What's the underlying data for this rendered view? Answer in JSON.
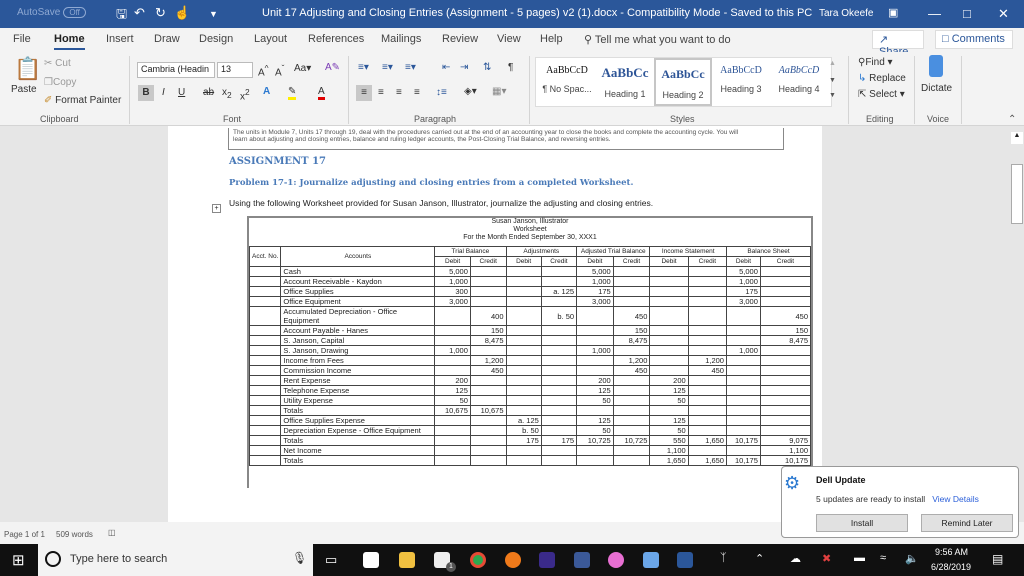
{
  "titlebar": {
    "autosave_label": "AutoSave",
    "autosave_state": "Off",
    "doc_title": "Unit 17 Adjusting and Closing Entries (Assignment - 5 pages) v2 (1).docx  -  Compatibility Mode  -  Saved to this PC",
    "user": "Tara Okeefe"
  },
  "tabs": [
    "File",
    "Home",
    "Insert",
    "Draw",
    "Design",
    "Layout",
    "References",
    "Mailings",
    "Review",
    "View",
    "Help"
  ],
  "active_tab": "Home",
  "tell_me": "Tell me what you want to do",
  "share_label": "Share",
  "comments_label": "Comments",
  "ribbon": {
    "clipboard": {
      "paste": "Paste",
      "cut": "Cut",
      "copy": "Copy",
      "format_painter": "Format Painter",
      "label": "Clipboard"
    },
    "font": {
      "name": "Cambria (Headin",
      "size": "13",
      "label": "Font"
    },
    "paragraph": {
      "label": "Paragraph"
    },
    "styles": {
      "label": "Styles",
      "items": [
        {
          "preview": "AaBbCcD",
          "name": "¶ No Spac..."
        },
        {
          "preview": "AaBbCc",
          "name": "Heading 1"
        },
        {
          "preview": "AaBbCc",
          "name": "Heading 2"
        },
        {
          "preview": "AaBbCcD",
          "name": "Heading 3"
        },
        {
          "preview": "AaBbCcD",
          "name": "Heading 4"
        }
      ],
      "selected": "Heading 2"
    },
    "editing": {
      "find": "Find",
      "replace": "Replace",
      "select": "Select",
      "label": "Editing"
    },
    "voice": {
      "dictate": "Dictate",
      "label": "Voice"
    }
  },
  "document": {
    "intro_line1": "The units in Module 7, Units 17 through 19, deal with the procedures carried out at the end of an accounting year to close the books and complete the accounting cycle.  You will",
    "intro_line2": "learn about adjusting and closing entries, balance and ruling ledger accounts, the Post-Closing Trial Balance, and reversing entries.",
    "assignment": "ASSIGNMENT 17",
    "problem": "Problem 17-1:  Journalize adjusting and closing entries from a completed Worksheet.",
    "instruction": "Using the following Worksheet provided for Susan Janson, Illustrator, journalize the adjusting and closing entries.",
    "worksheet": {
      "company": "Susan Janson, Illustrator",
      "title": "Worksheet",
      "period": "For the Month Ended September 30, XXX1",
      "col_groups": [
        "Trial Balance",
        "Adjustments",
        "Adjusted Trial Balance",
        "Income Statement",
        "Balance Sheet"
      ],
      "acct_no": "Acct. No.",
      "accounts_header": "Accounts",
      "debit": "Debit",
      "credit": "Credit",
      "rows": [
        {
          "acct": "Cash",
          "tb_dr": "5,000",
          "tb_cr": "",
          "adj_dr": "",
          "adj_cr": "",
          "atb_dr": "5,000",
          "atb_cr": "",
          "is_dr": "",
          "is_cr": "",
          "bs_dr": "5,000",
          "bs_cr": ""
        },
        {
          "acct": "Account Receivable - Kaydon",
          "tb_dr": "1,000",
          "tb_cr": "",
          "adj_dr": "",
          "adj_cr": "",
          "atb_dr": "1,000",
          "atb_cr": "",
          "is_dr": "",
          "is_cr": "",
          "bs_dr": "1,000",
          "bs_cr": ""
        },
        {
          "acct": "Office Supplies",
          "tb_dr": "300",
          "tb_cr": "",
          "adj_dr": "",
          "adj_cr": "a.  125",
          "atb_dr": "175",
          "atb_cr": "",
          "is_dr": "",
          "is_cr": "",
          "bs_dr": "175",
          "bs_cr": ""
        },
        {
          "acct": "Office Equipment",
          "tb_dr": "3,000",
          "tb_cr": "",
          "adj_dr": "",
          "adj_cr": "",
          "atb_dr": "3,000",
          "atb_cr": "",
          "is_dr": "",
          "is_cr": "",
          "bs_dr": "3,000",
          "bs_cr": ""
        },
        {
          "acct": "Accumulated Depreciation - Office Equipment",
          "tb_dr": "",
          "tb_cr": "400",
          "adj_dr": "",
          "adj_cr": "b.   50",
          "atb_dr": "",
          "atb_cr": "450",
          "is_dr": "",
          "is_cr": "",
          "bs_dr": "",
          "bs_cr": "450"
        },
        {
          "acct": "Account Payable - Hanes",
          "tb_dr": "",
          "tb_cr": "150",
          "adj_dr": "",
          "adj_cr": "",
          "atb_dr": "",
          "atb_cr": "150",
          "is_dr": "",
          "is_cr": "",
          "bs_dr": "",
          "bs_cr": "150"
        },
        {
          "acct": "S. Janson, Capital",
          "tb_dr": "",
          "tb_cr": "8,475",
          "adj_dr": "",
          "adj_cr": "",
          "atb_dr": "",
          "atb_cr": "8,475",
          "is_dr": "",
          "is_cr": "",
          "bs_dr": "",
          "bs_cr": "8,475"
        },
        {
          "acct": "S. Janson, Drawing",
          "tb_dr": "1,000",
          "tb_cr": "",
          "adj_dr": "",
          "adj_cr": "",
          "atb_dr": "1,000",
          "atb_cr": "",
          "is_dr": "",
          "is_cr": "",
          "bs_dr": "1,000",
          "bs_cr": ""
        },
        {
          "acct": "Income from Fees",
          "tb_dr": "",
          "tb_cr": "1,200",
          "adj_dr": "",
          "adj_cr": "",
          "atb_dr": "",
          "atb_cr": "1,200",
          "is_dr": "",
          "is_cr": "1,200",
          "bs_dr": "",
          "bs_cr": ""
        },
        {
          "acct": "Commission Income",
          "tb_dr": "",
          "tb_cr": "450",
          "adj_dr": "",
          "adj_cr": "",
          "atb_dr": "",
          "atb_cr": "450",
          "is_dr": "",
          "is_cr": "450",
          "bs_dr": "",
          "bs_cr": ""
        },
        {
          "acct": "Rent Expense",
          "tb_dr": "200",
          "tb_cr": "",
          "adj_dr": "",
          "adj_cr": "",
          "atb_dr": "200",
          "atb_cr": "",
          "is_dr": "200",
          "is_cr": "",
          "bs_dr": "",
          "bs_cr": ""
        },
        {
          "acct": "Telephone Expense",
          "tb_dr": "125",
          "tb_cr": "",
          "adj_dr": "",
          "adj_cr": "",
          "atb_dr": "125",
          "atb_cr": "",
          "is_dr": "125",
          "is_cr": "",
          "bs_dr": "",
          "bs_cr": ""
        },
        {
          "acct": "Utility Expense",
          "tb_dr": "50",
          "tb_cr": "",
          "adj_dr": "",
          "adj_cr": "",
          "atb_dr": "50",
          "atb_cr": "",
          "is_dr": "50",
          "is_cr": "",
          "bs_dr": "",
          "bs_cr": ""
        },
        {
          "acct": "   Totals",
          "tb_dr": "10,675",
          "tb_cr": "10,675",
          "adj_dr": "",
          "adj_cr": "",
          "atb_dr": "",
          "atb_cr": "",
          "is_dr": "",
          "is_cr": "",
          "bs_dr": "",
          "bs_cr": ""
        },
        {
          "acct": "Office Supplies Expense",
          "tb_dr": "",
          "tb_cr": "",
          "adj_dr": "a.    125",
          "adj_cr": "",
          "atb_dr": "125",
          "atb_cr": "",
          "is_dr": "125",
          "is_cr": "",
          "bs_dr": "",
          "bs_cr": ""
        },
        {
          "acct": "Depreciation Expense - Office Equipment",
          "tb_dr": "",
          "tb_cr": "",
          "adj_dr": "b.     50",
          "adj_cr": "",
          "atb_dr": "50",
          "atb_cr": "",
          "is_dr": "50",
          "is_cr": "",
          "bs_dr": "",
          "bs_cr": ""
        },
        {
          "acct": "   Totals",
          "tb_dr": "",
          "tb_cr": "",
          "adj_dr": "175",
          "adj_cr": "175",
          "atb_dr": "10,725",
          "atb_cr": "10,725",
          "is_dr": "550",
          "is_cr": "1,650",
          "bs_dr": "10,175",
          "bs_cr": "9,075"
        },
        {
          "acct": "Net Income",
          "tb_dr": "",
          "tb_cr": "",
          "adj_dr": "",
          "adj_cr": "",
          "atb_dr": "",
          "atb_cr": "",
          "is_dr": "1,100",
          "is_cr": "",
          "bs_dr": "",
          "bs_cr": "1,100"
        },
        {
          "acct": "   Totals",
          "tb_dr": "",
          "tb_cr": "",
          "adj_dr": "",
          "adj_cr": "",
          "atb_dr": "",
          "atb_cr": "",
          "is_dr": "1,650",
          "is_cr": "1,650",
          "bs_dr": "10,175",
          "bs_cr": "10,175"
        }
      ]
    }
  },
  "statusbar": {
    "page": "Page 1 of 1",
    "words": "509 words"
  },
  "toast": {
    "title": "Dell Update",
    "message": "5 updates are ready to install",
    "link": "View Details",
    "install": "Install",
    "remind": "Remind Later"
  },
  "taskbar": {
    "search_placeholder": "Type here to search",
    "time": "9:56 AM",
    "date": "6/28/2019",
    "mail_badge": "1"
  }
}
